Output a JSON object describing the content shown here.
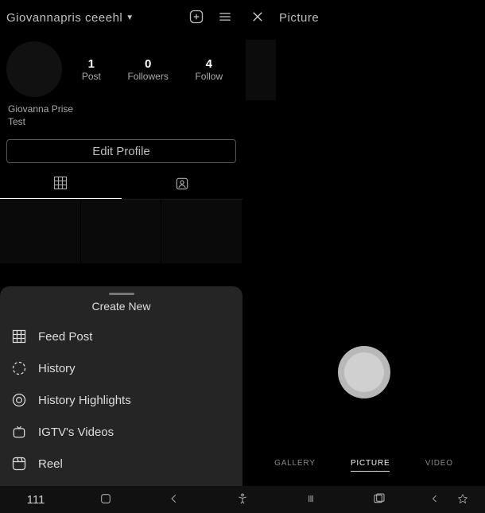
{
  "left": {
    "username": "Giovannapris ceeehl",
    "stats": {
      "posts_count": "1",
      "posts_label": "Post",
      "followers_count": "0",
      "followers_label": "Followers",
      "following_count": "4",
      "following_label": "Follow"
    },
    "bio_name": "Giovanna Prise",
    "bio_text": "Test",
    "edit_button": "Edit Profile"
  },
  "sheet": {
    "title": "Create New",
    "items": {
      "feed": "Feed Post",
      "history": "History",
      "highlights": "History Highlights",
      "igtv": "IGTV's Videos",
      "reel": "Reel"
    }
  },
  "right": {
    "title": "Picture",
    "camtabs": {
      "gallery": "GALLERY",
      "picture": "PICTURE",
      "video": "VIDEO"
    }
  },
  "nav": {
    "counter": "111"
  }
}
